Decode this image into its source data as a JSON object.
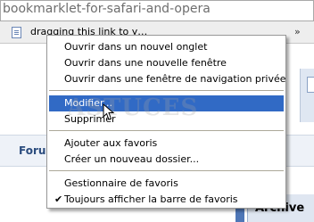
{
  "address_bar": {
    "url_text": "bookmarklet-for-safari-and-opera"
  },
  "bookmarks_bar": {
    "item_label": "dragging this link to y…",
    "chevron": "»"
  },
  "page": {
    "forum_label": "Forum",
    "archive_label": "Archive"
  },
  "context_menu": {
    "items": [
      {
        "label": "Ouvrir dans un nouvel onglet"
      },
      {
        "label": "Ouvrir dans une nouvelle fenêtre"
      },
      {
        "label": "Ouvrir dans une fenêtre de navigation privée"
      },
      {
        "label": "Modifier..."
      },
      {
        "label": "Supprimer"
      },
      {
        "label": "Ajouter aux favoris"
      },
      {
        "label": "Créer un nouveau dossier..."
      },
      {
        "label": "Gestionnaire de favoris"
      },
      {
        "label": "Toujours afficher la barre de favoris",
        "checked": true
      }
    ],
    "highlighted_index": 3,
    "check_mark": "✔"
  },
  "watermark": {
    "text": "ASTUCES"
  },
  "colors": {
    "highlight": "#316ac5",
    "separator": "#aca899",
    "accent_blue": "#4f77b7"
  }
}
